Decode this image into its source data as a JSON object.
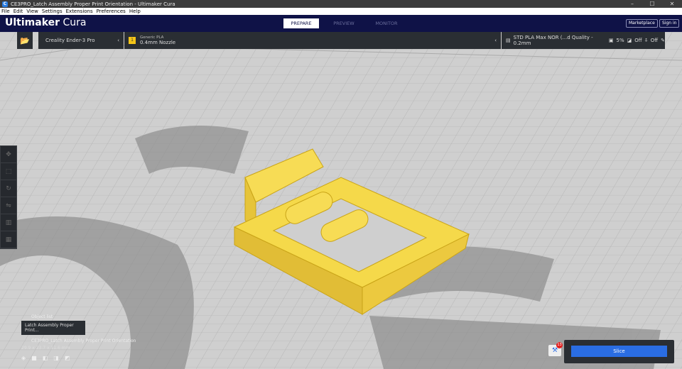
{
  "window": {
    "title": "CE3PRO_Latch Assembly Proper Print Orientation - Ultimaker Cura",
    "icon": "cura-icon"
  },
  "menu": [
    "File",
    "Edit",
    "View",
    "Settings",
    "Extensions",
    "Preferences",
    "Help"
  ],
  "header": {
    "logo_bold": "Ultimaker",
    "logo_light": " Cura",
    "tabs": [
      "PREPARE",
      "PREVIEW",
      "MONITOR"
    ],
    "marketplace": "Marketplace",
    "signin": "Sign in"
  },
  "printer": {
    "name": "Creality Ender-3 Pro",
    "material": "Generic PLA",
    "nozzle": "0.4mm Nozzle"
  },
  "settings": {
    "profile": "STD PLA Max NOR (...d Quality - 0.2mm",
    "infill": "5%",
    "support": "Off",
    "adhesion": "Off"
  },
  "object_list": {
    "label": "Object list",
    "item": "Latch Assembly Proper Print...",
    "file": "CE3PRO_Latch Assembly Proper Print Orientation",
    "dims": "29.9 x 23.7 x 11.6 mm"
  },
  "slice": {
    "label": "Slice",
    "badge": "13"
  },
  "colors": {
    "header": "#0f1247",
    "model": "#f5d94a",
    "slice": "#2a6de3"
  }
}
